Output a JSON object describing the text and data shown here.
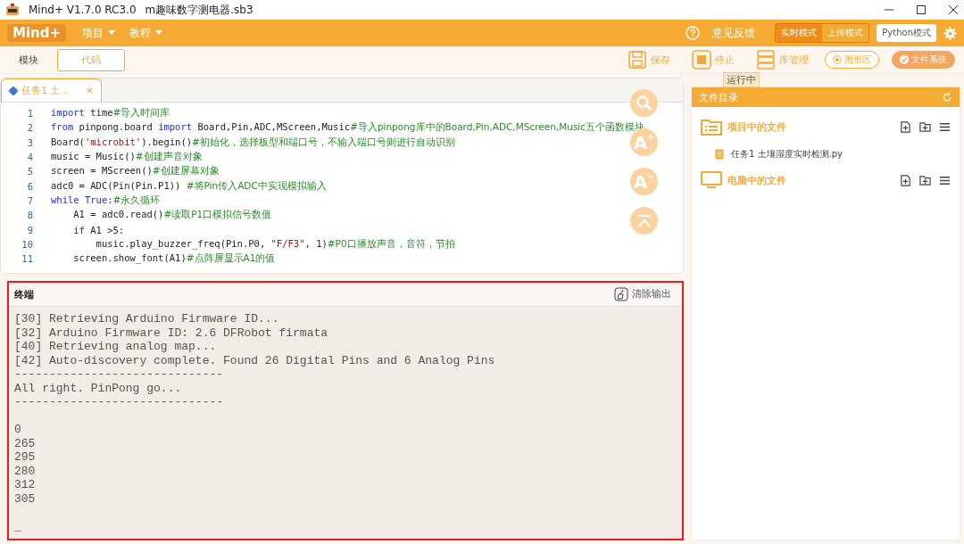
{
  "window": {
    "title": "Mind+ V1.7.0 RC3.0",
    "file": "m趣味数字测电器.sb3"
  },
  "menubar": {
    "logo": "Mind+",
    "menus": [
      {
        "label": "项目"
      },
      {
        "label": "教程"
      }
    ],
    "feedback": "意见反馈",
    "modes": [
      {
        "label": "实时模式",
        "selected": true
      },
      {
        "label": "上传模式",
        "selected": false
      }
    ],
    "python_mode": {
      "label": "Python模式",
      "on": true
    }
  },
  "view_tabs": [
    {
      "label": "模块",
      "selected": false
    },
    {
      "label": "代码",
      "selected": true
    }
  ],
  "toolbar": [
    {
      "label": "保存",
      "kind": "save"
    },
    {
      "label": "停止",
      "kind": "stop"
    },
    {
      "label": "库管理",
      "kind": "library"
    }
  ],
  "toggles": [
    {
      "label": "图形区",
      "on": false
    },
    {
      "label": "文件系统",
      "on": true
    }
  ],
  "tooltip": "运行中",
  "editor": {
    "tab": {
      "label": "任务1 土...",
      "close": "×"
    },
    "lines": [
      {
        "number": "1",
        "tokens": [
          {
            "kind": "keyword",
            "text": "import"
          },
          {
            "kind": "plain",
            "text": " time"
          },
          {
            "kind": "comment",
            "text": "#导入时间库"
          }
        ]
      },
      {
        "number": "2",
        "tokens": [
          {
            "kind": "keyword",
            "text": "from"
          },
          {
            "kind": "plain",
            "text": " pinpong.board "
          },
          {
            "kind": "keyword",
            "text": "import"
          },
          {
            "kind": "plain",
            "text": " Board,Pin,ADC,MScreen,Music"
          },
          {
            "kind": "comment",
            "text": "#导入pinpong库中的Board,Pin,ADC,MScreen,Music五个函数模块"
          }
        ]
      },
      {
        "number": "3",
        "tokens": [
          {
            "kind": "plain",
            "text": "Board("
          },
          {
            "kind": "string",
            "text": "'microbit'"
          },
          {
            "kind": "plain",
            "text": ").begin()"
          },
          {
            "kind": "comment",
            "text": "#初始化，选择板型和端口号，不输入端口号则进行自动识别"
          }
        ]
      },
      {
        "number": "4",
        "tokens": [
          {
            "kind": "plain",
            "text": "music = Music()"
          },
          {
            "kind": "comment",
            "text": "#创建声音对象"
          }
        ]
      },
      {
        "number": "5",
        "tokens": [
          {
            "kind": "plain",
            "text": "screen = MScreen()"
          },
          {
            "kind": "comment",
            "text": "#创建屏幕对象"
          }
        ]
      },
      {
        "number": "6",
        "tokens": [
          {
            "kind": "plain",
            "text": "adc0 = ADC(Pin(Pin.P1)) "
          },
          {
            "kind": "comment",
            "text": "#将Pin传入ADC中实现模拟输入"
          }
        ]
      },
      {
        "number": "7",
        "tokens": [
          {
            "kind": "keyword",
            "text": "while True"
          },
          {
            "kind": "plain",
            "text": ":"
          },
          {
            "kind": "comment",
            "text": "#永久循环"
          }
        ]
      },
      {
        "number": "8",
        "tokens": [
          {
            "kind": "plain",
            "text": "    A1 = adc0.read()"
          },
          {
            "kind": "comment",
            "text": "#读取P1口模拟信号数值"
          }
        ]
      },
      {
        "number": "9",
        "tokens": [
          {
            "kind": "keyword",
            "text": "    if"
          },
          {
            "kind": "plain",
            "text": " A1 >5:"
          }
        ]
      },
      {
        "number": "10",
        "tokens": [
          {
            "kind": "plain",
            "text": "        music.play_buzzer_freq(Pin.P0, "
          },
          {
            "kind": "string",
            "text": "\"F/F3\""
          },
          {
            "kind": "plain",
            "text": ", 1)"
          },
          {
            "kind": "comment",
            "text": "#P0口播放声音，音符，节拍"
          }
        ]
      },
      {
        "number": "11",
        "tokens": [
          {
            "kind": "plain",
            "text": "    screen.show_font(A1)"
          },
          {
            "kind": "comment",
            "text": "#点阵屏显示A1的值"
          }
        ]
      }
    ]
  },
  "tools": [
    {
      "kind": "search"
    },
    {
      "kind": "font_up",
      "glyph": "A"
    },
    {
      "kind": "font_down",
      "glyph": "A"
    },
    {
      "kind": "collapse"
    }
  ],
  "terminal": {
    "title": "终端",
    "clear": "清除输出",
    "blocks": [
      [
        "[30] Retrieving Arduino Firmware ID...",
        "[32] Arduino Firmware ID: 2.6 DFRobot firmata",
        "[40] Retrieving analog map...",
        "[42] Auto-discovery complete. Found 26 Digital Pins and 6 Analog Pins",
        "------------------------------",
        "All right. PinPong go...",
        "------------------------------"
      ],
      [
        "0",
        "265",
        "295",
        "280",
        "312",
        "305"
      ],
      [
        "_"
      ]
    ]
  },
  "files": {
    "title": "文件目录",
    "sections": [
      {
        "title": "项目中的文件",
        "kind": "project",
        "files": [
          "任务1 土壤湿度实时检测.py"
        ]
      },
      {
        "title": "电脑中的文件",
        "kind": "computer"
      }
    ]
  }
}
